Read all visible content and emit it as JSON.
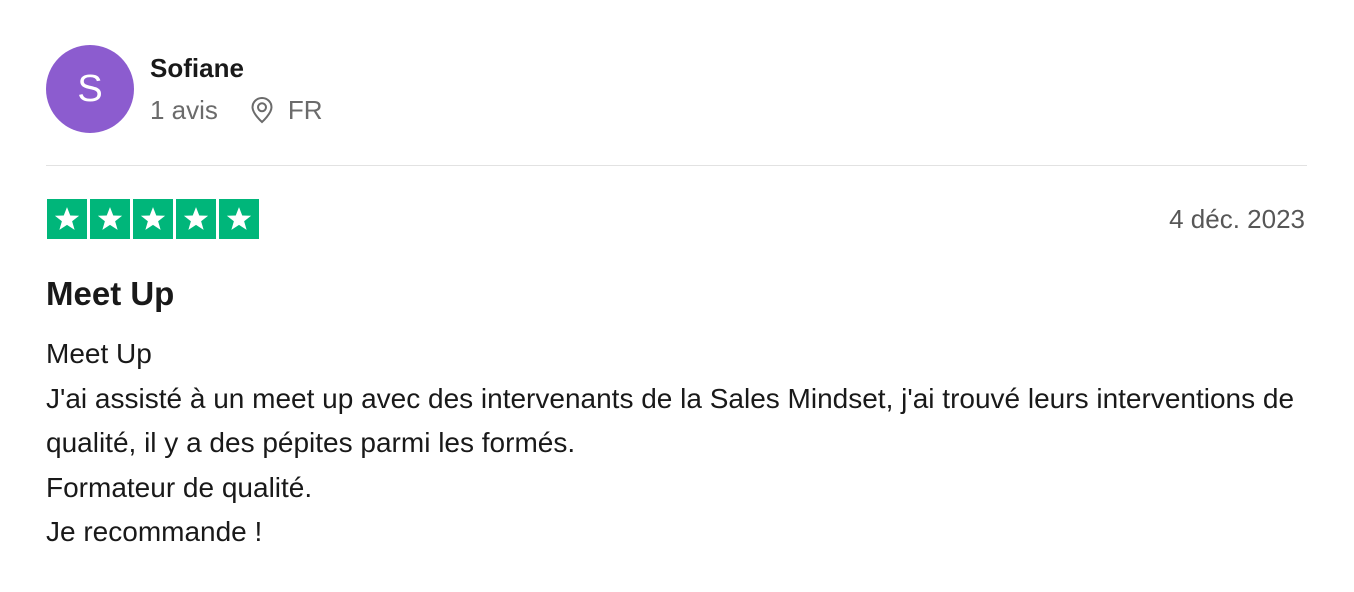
{
  "reviewer": {
    "initial": "S",
    "name": "Sofiane",
    "review_count": "1 avis",
    "country": "FR",
    "avatar_color": "#8c5ccf"
  },
  "review": {
    "rating": 5,
    "rating_max": 5,
    "star_color": "#00b67a",
    "date": "4 déc. 2023",
    "title": "Meet Up",
    "body_lines": [
      "Meet Up",
      "J'ai assisté à un meet up avec des intervenants de la Sales Mindset, j'ai trouvé leurs interventions de qualité, il y a des pépites parmi les formés.",
      "Formateur de qualité.",
      "Je recommande !"
    ]
  },
  "icons": {
    "location": "location-pin-icon",
    "star": "star-icon"
  }
}
